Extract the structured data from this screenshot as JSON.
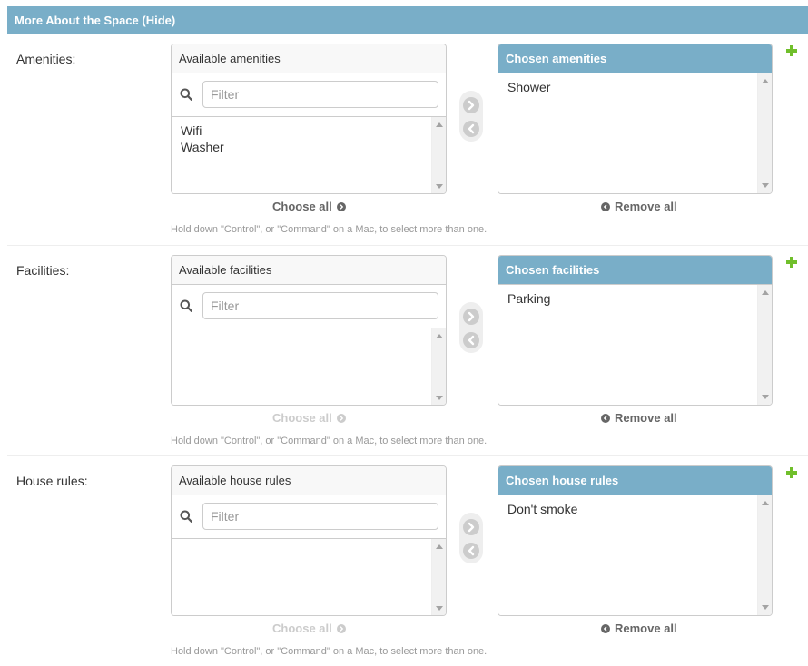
{
  "fieldset": {
    "title": "More About the Space",
    "toggle_label": "(Hide)"
  },
  "rows": [
    {
      "label": "Amenities:",
      "available_title": "Available amenities",
      "filter_placeholder": "Filter",
      "available_options": [
        "Wifi",
        "Washer"
      ],
      "chosen_title": "Chosen amenities",
      "chosen_options": [
        "Shower"
      ],
      "choose_all_label": "Choose all",
      "choose_all_enabled": true,
      "remove_all_label": "Remove all",
      "help": "Hold down \"Control\", or \"Command\" on a Mac, to select more than one."
    },
    {
      "label": "Facilities:",
      "available_title": "Available facilities",
      "filter_placeholder": "Filter",
      "available_options": [],
      "chosen_title": "Chosen facilities",
      "chosen_options": [
        "Parking"
      ],
      "choose_all_label": "Choose all",
      "choose_all_enabled": false,
      "remove_all_label": "Remove all",
      "help": "Hold down \"Control\", or \"Command\" on a Mac, to select more than one."
    },
    {
      "label": "House rules:",
      "available_title": "Available house rules",
      "filter_placeholder": "Filter",
      "available_options": [],
      "chosen_title": "Chosen house rules",
      "chosen_options": [
        "Don't smoke"
      ],
      "choose_all_label": "Choose all",
      "choose_all_enabled": false,
      "remove_all_label": "Remove all",
      "help": "Hold down \"Control\", or \"Command\" on a Mac, to select more than one."
    }
  ],
  "colors": {
    "header_bg": "#79aec8",
    "add_related": "#70bf2b",
    "disabled_text": "#cccccc"
  },
  "icons": {
    "search": "search-icon",
    "choose_all": "circle-arrow-right-icon",
    "remove_all": "circle-arrow-left-icon",
    "add_related": "plus-icon"
  }
}
